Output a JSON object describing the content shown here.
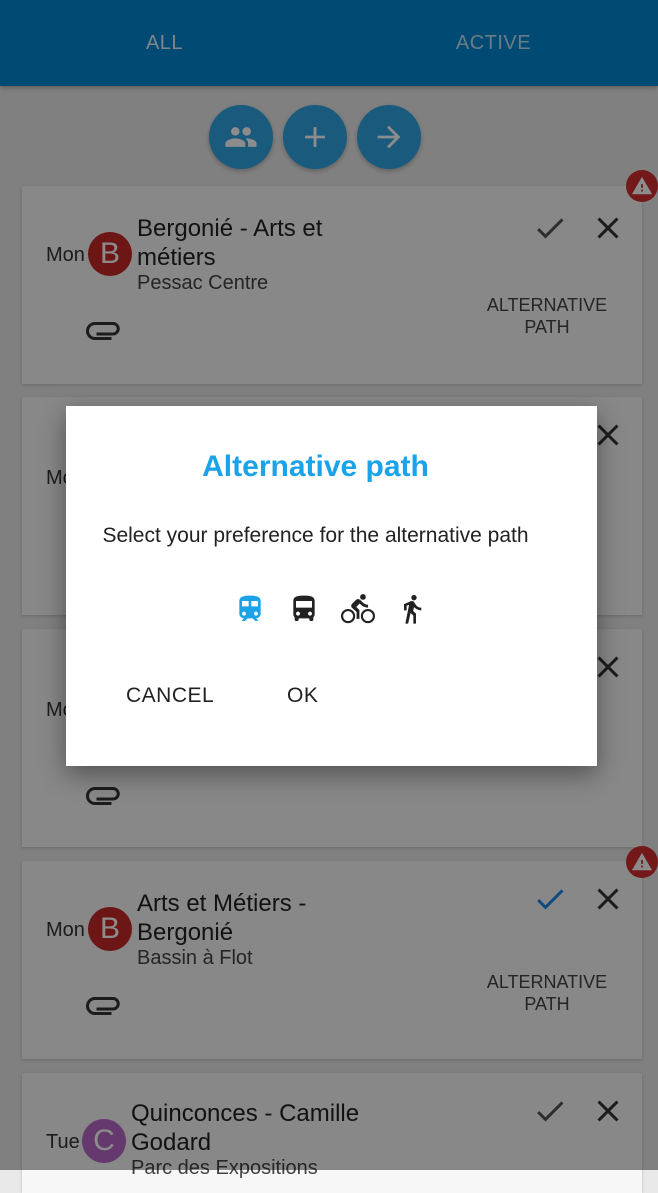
{
  "tabs": [
    {
      "label": "ALL"
    },
    {
      "label": "ACTIVE"
    }
  ],
  "fabs": [
    {
      "icon": "people-icon"
    },
    {
      "icon": "plus-icon"
    },
    {
      "icon": "arrow-right-icon"
    }
  ],
  "cards": [
    {
      "day": "Mon",
      "avatar": "B",
      "avatar_color": "#c62828",
      "title": "Bergonié - Arts et métiers",
      "subtitle": "Pessac Centre",
      "action": "ALTERNATIVE PATH",
      "warning": true,
      "check_color": "#555555"
    },
    {
      "day": "Mc",
      "avatar": "",
      "title": "",
      "subtitle": "",
      "action": "",
      "warning": false
    },
    {
      "day": "Mc",
      "avatar": "",
      "title": "",
      "subtitle": "",
      "action": "",
      "warning": false
    },
    {
      "day": "Mon",
      "avatar": "B",
      "avatar_color": "#c62828",
      "title": "Arts et Métiers - Bergonié",
      "subtitle": "Bassin à Flot",
      "action": "ALTERNATIVE PATH",
      "warning": true,
      "check_color": "#1e88e5"
    },
    {
      "day": "Tue",
      "avatar": "C",
      "avatar_color": "#ba68c8",
      "title": "Quinconces - Camille Godard",
      "subtitle": "Parc des Expositions",
      "action": "",
      "warning": false,
      "check_color": "#555555"
    }
  ],
  "dialog": {
    "title": "Alternative path",
    "message": "Select your preference for the alternative path",
    "modes": [
      {
        "icon": "tram-icon",
        "selected": true,
        "color": "#1aa3e8"
      },
      {
        "icon": "bus-icon",
        "selected": false
      },
      {
        "icon": "bike-icon",
        "selected": false
      },
      {
        "icon": "walk-icon",
        "selected": false
      }
    ],
    "cancel_label": "CANCEL",
    "ok_label": "OK"
  }
}
